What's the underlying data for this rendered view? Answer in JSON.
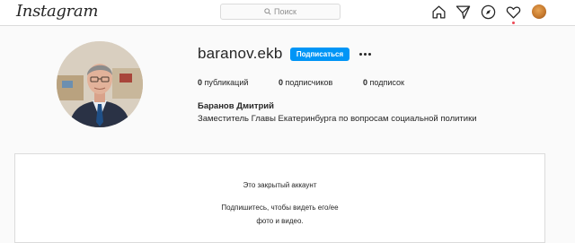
{
  "topbar": {
    "logo": "Instagram",
    "search_placeholder": "Поиск",
    "icons": [
      "home-icon",
      "direct-icon",
      "explore-icon",
      "activity-heart-icon",
      "profile-avatar"
    ]
  },
  "profile": {
    "username": "baranov.ekb",
    "follow_label": "Подписаться",
    "stats": {
      "posts_count": "0",
      "posts_label": "публикаций",
      "followers_count": "0",
      "followers_label": "подписчиков",
      "following_count": "0",
      "following_label": "подписок"
    },
    "full_name": "Баранов Дмитрий",
    "bio": "Заместитель Главы Екатеринбурга по вопросам социальной политики"
  },
  "private_notice": {
    "title": "Это закрытый аккаунт",
    "line1": "Подпишитесь, чтобы видеть его/ее",
    "line2": "фото и видео."
  },
  "colors": {
    "accent": "#0095f6",
    "border": "#dbdbdb",
    "background": "#fafafa",
    "notification_dot": "#ed4956"
  }
}
